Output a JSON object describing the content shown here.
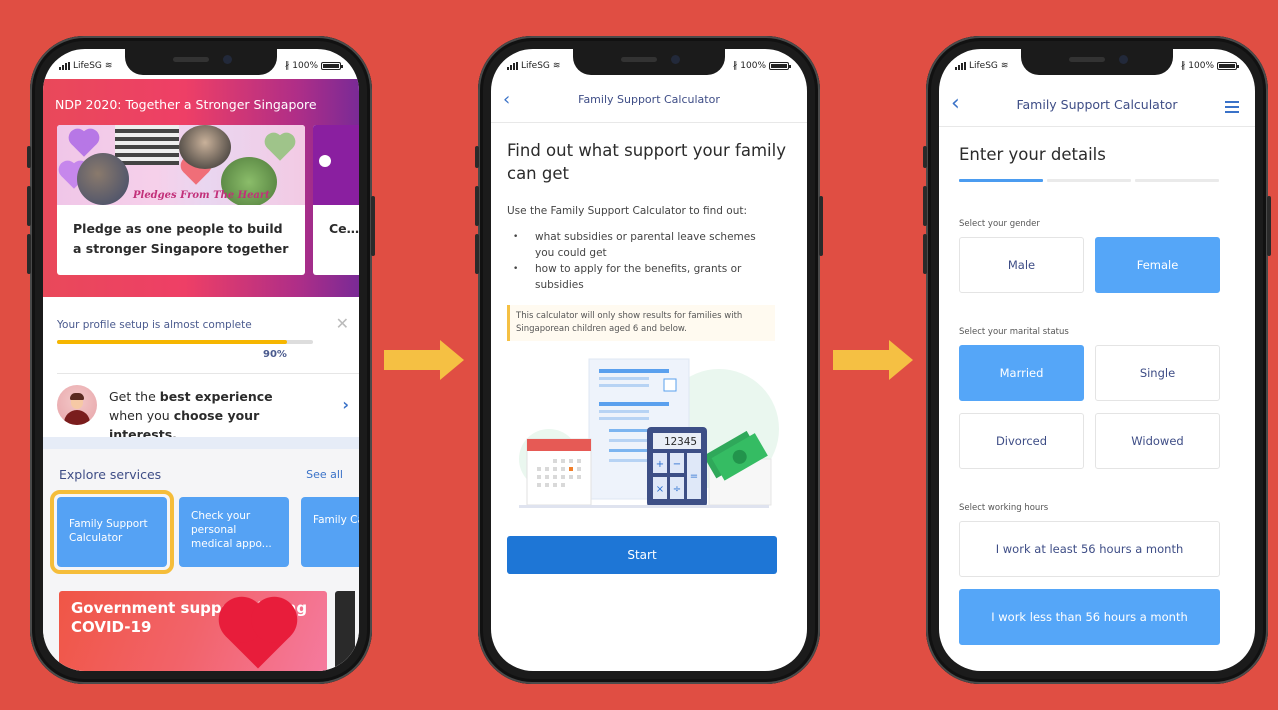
{
  "colors": {
    "background": "#e04e43",
    "accent_blue": "#55a6f8",
    "primary_button": "#1e76d6",
    "arrow_yellow": "#f5c043",
    "progress_yellow": "#f6b600",
    "nav_text": "#3e4d86"
  },
  "status_bar": {
    "carrier": "LifeSG",
    "battery": "100%",
    "icons": [
      "signal-icon",
      "wifi-icon",
      "bluetooth-icon",
      "battery-icon"
    ]
  },
  "screen1": {
    "banner_title": "NDP 2020: Together a Stronger Singapore",
    "cards": [
      {
        "image_caption": "Pledges From The Heart",
        "text": "Pledge as one people to build a stronger Singapore together"
      },
      {
        "text": "Ce… dis…"
      }
    ],
    "profile": {
      "title": "Your profile setup is almost complete",
      "progress_percent": 90,
      "progress_label": "90%",
      "interest_text": {
        "part1": "Get the ",
        "bold1": "best experience",
        "part2": " when you ",
        "bold2": "choose your interests."
      }
    },
    "explore": {
      "title": "Explore services",
      "see_all": "See all",
      "services": [
        {
          "label": "Family Support Calculator",
          "highlighted": true
        },
        {
          "label": "Check your personal medical appo...",
          "highlighted": false
        },
        {
          "label": "Family Calcu…",
          "highlighted": false
        }
      ]
    },
    "promo": {
      "text": "Government support during COVID-19"
    }
  },
  "screen2": {
    "nav_title": "Family Support Calculator",
    "heading": "Find out what support your family can get",
    "intro": "Use the Family Support Calculator to find out:",
    "bullets": [
      "what subsidies or parental leave schemes you could get",
      "how to apply for the benefits, grants or subsidies"
    ],
    "notice": "This calculator will only show results for families with Singaporean children aged 6 and below.",
    "calculator_display": "12345",
    "start_button": "Start"
  },
  "screen3": {
    "nav_title": "Family Support Calculator",
    "heading": "Enter your details",
    "steps": {
      "current": 1,
      "total": 3
    },
    "gender": {
      "label": "Select your gender",
      "options": [
        "Male",
        "Female"
      ],
      "selected": "Female"
    },
    "marital": {
      "label": "Select your marital status",
      "options": [
        "Married",
        "Single",
        "Divorced",
        "Widowed"
      ],
      "selected": "Married"
    },
    "working": {
      "label": "Select working hours",
      "options": [
        "I work at least 56 hours a month",
        "I work less than 56 hours a month"
      ],
      "selected": "I work less than 56 hours a month"
    }
  }
}
